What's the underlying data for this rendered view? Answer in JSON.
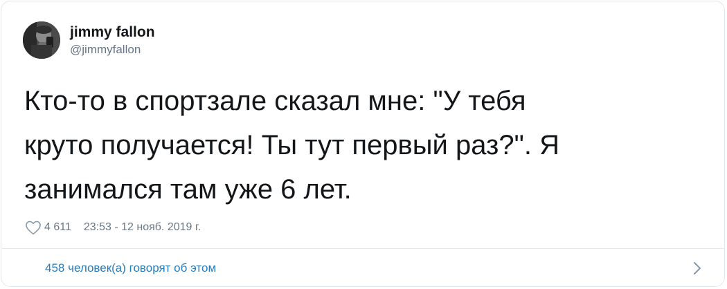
{
  "author": {
    "display_name": "jimmy fallon",
    "handle": "@jimmyfallon",
    "avatar_icon": "user-avatar"
  },
  "tweet": {
    "lines": [
      "Кто-то в спортзале сказал мне: \"У тебя",
      "круто получается! Ты тут первый раз?\". Я",
      "занимался там уже 6 лет."
    ]
  },
  "meta": {
    "like_icon": "heart-outline-icon",
    "like_count": "4 611",
    "timestamp": "23:53 - 12 нояб. 2019 г."
  },
  "footer": {
    "link_text": "458 человек(а) говорят об этом",
    "chevron_icon": "chevron-right-icon"
  },
  "colors": {
    "text_primary": "#14171a",
    "text_secondary": "#657786",
    "link": "#2b7bb9",
    "border": "#e1e8ed"
  }
}
